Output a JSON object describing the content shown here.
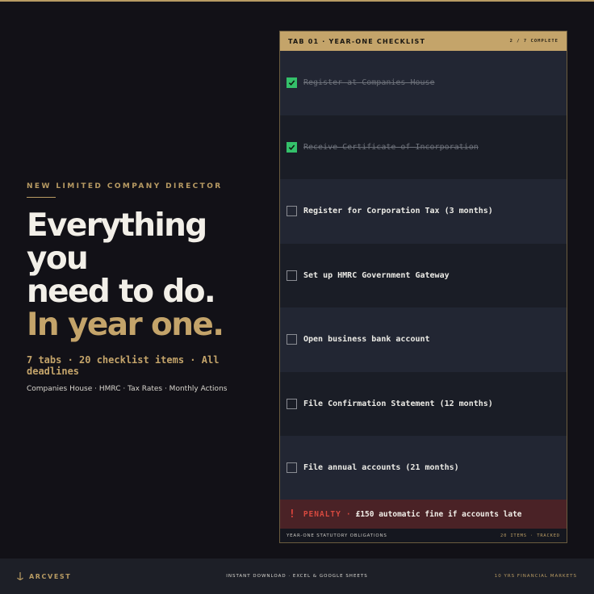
{
  "hero": {
    "eyebrow": "NEW LIMITED COMPANY DIRECTOR",
    "headline_lines": [
      "Everything",
      "you",
      "need to do."
    ],
    "headline_accent": "In year one.",
    "stats": "7 tabs · 20 checklist items · All deadlines",
    "subline": "Companies House · HMRC · Tax Rates · Monthly Actions"
  },
  "checklist": {
    "title": "TAB 01 · YEAR-ONE CHECKLIST",
    "progress": "2 / 7 COMPLETE",
    "items": [
      {
        "label": "Register at Companies House",
        "checked": true
      },
      {
        "label": "Receive Certificate of Incorporation",
        "checked": true
      },
      {
        "label": "Register for Corporation Tax (3 months)",
        "checked": false
      },
      {
        "label": "Set up HMRC Government Gateway",
        "checked": false
      },
      {
        "label": "Open business bank account",
        "checked": false
      },
      {
        "label": "File Confirmation Statement (12 months)",
        "checked": false
      },
      {
        "label": "File annual accounts (21 months)",
        "checked": false
      }
    ],
    "penalty": {
      "icon": "!",
      "label": "PENALTY",
      "separator": "·",
      "text": "£150 automatic fine if accounts late"
    },
    "footer_left": "YEAR-ONE STATUTORY OBLIGATIONS",
    "footer_right": "20 ITEMS · TRACKED"
  },
  "bottom_bar": {
    "brand": "ARCVEST",
    "tagline": "INSTANT DOWNLOAD · EXCEL & GOOGLE SHEETS",
    "experience": "10 YRS FINANCIAL MARKETS"
  },
  "colors": {
    "background": "#121117",
    "gold": "#c4a46a",
    "check_green": "#34c06a",
    "penalty_red": "#d7493f"
  }
}
